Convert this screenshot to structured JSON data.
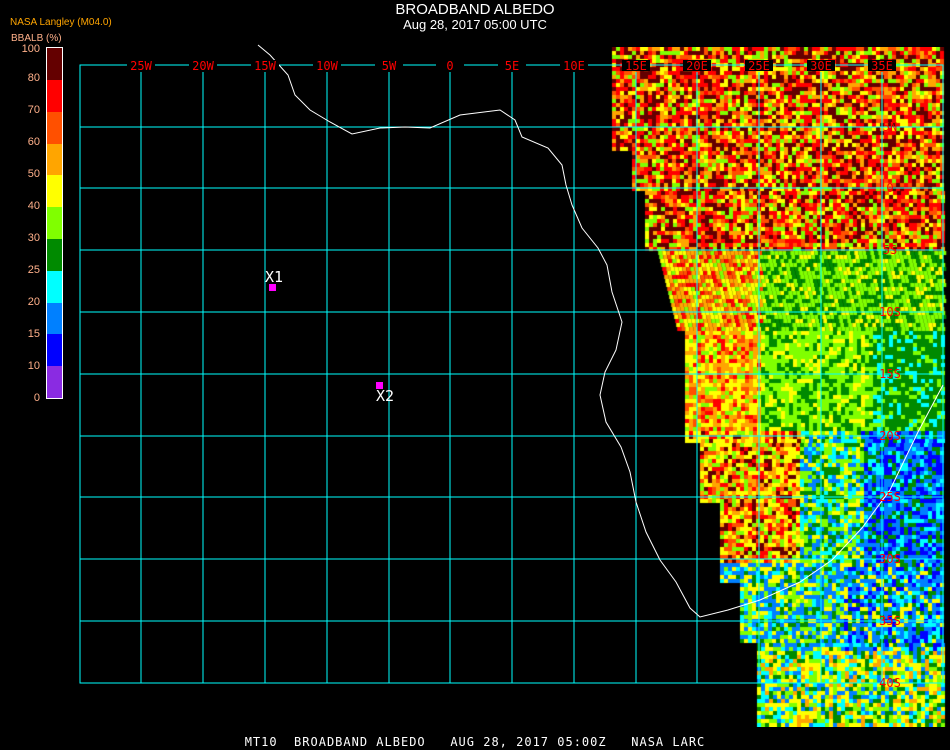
{
  "header": {
    "title": "BROADBAND ALBEDO",
    "subtitle": "Aug 28, 2017 05:00 UTC",
    "source": "NASA Langley (M04.0)"
  },
  "colorbar": {
    "unit_label": "BBALB (%)",
    "ticks": [
      "0",
      "10",
      "15",
      "20",
      "25",
      "30",
      "40",
      "50",
      "60",
      "70",
      "80",
      "100"
    ],
    "colors": [
      "#8a2be2",
      "#0000ff",
      "#0080ff",
      "#00ffff",
      "#008a00",
      "#80ff00",
      "#ffff00",
      "#ffa500",
      "#ff5000",
      "#ff0000",
      "#640000"
    ]
  },
  "map": {
    "lon_labels": [
      "25W",
      "20W",
      "15W",
      "10W",
      "5W",
      "0",
      "5E",
      "10E",
      "15E",
      "20E",
      "25E",
      "30E",
      "35E"
    ],
    "lat_labels": [
      "5N",
      "0",
      "5S",
      "10S",
      "15S",
      "20S",
      "25S",
      "30S",
      "35S",
      "40S"
    ],
    "grid_color": "#00ffff",
    "label_color": "#ff0000",
    "markers": [
      {
        "label": "X1"
      },
      {
        "label": "X2"
      }
    ],
    "marker_color": "#ff00ff"
  },
  "footer": {
    "text": "MT10  BROADBAND ALBEDO   AUG 28, 2017 05:00Z   NASA LARC"
  }
}
